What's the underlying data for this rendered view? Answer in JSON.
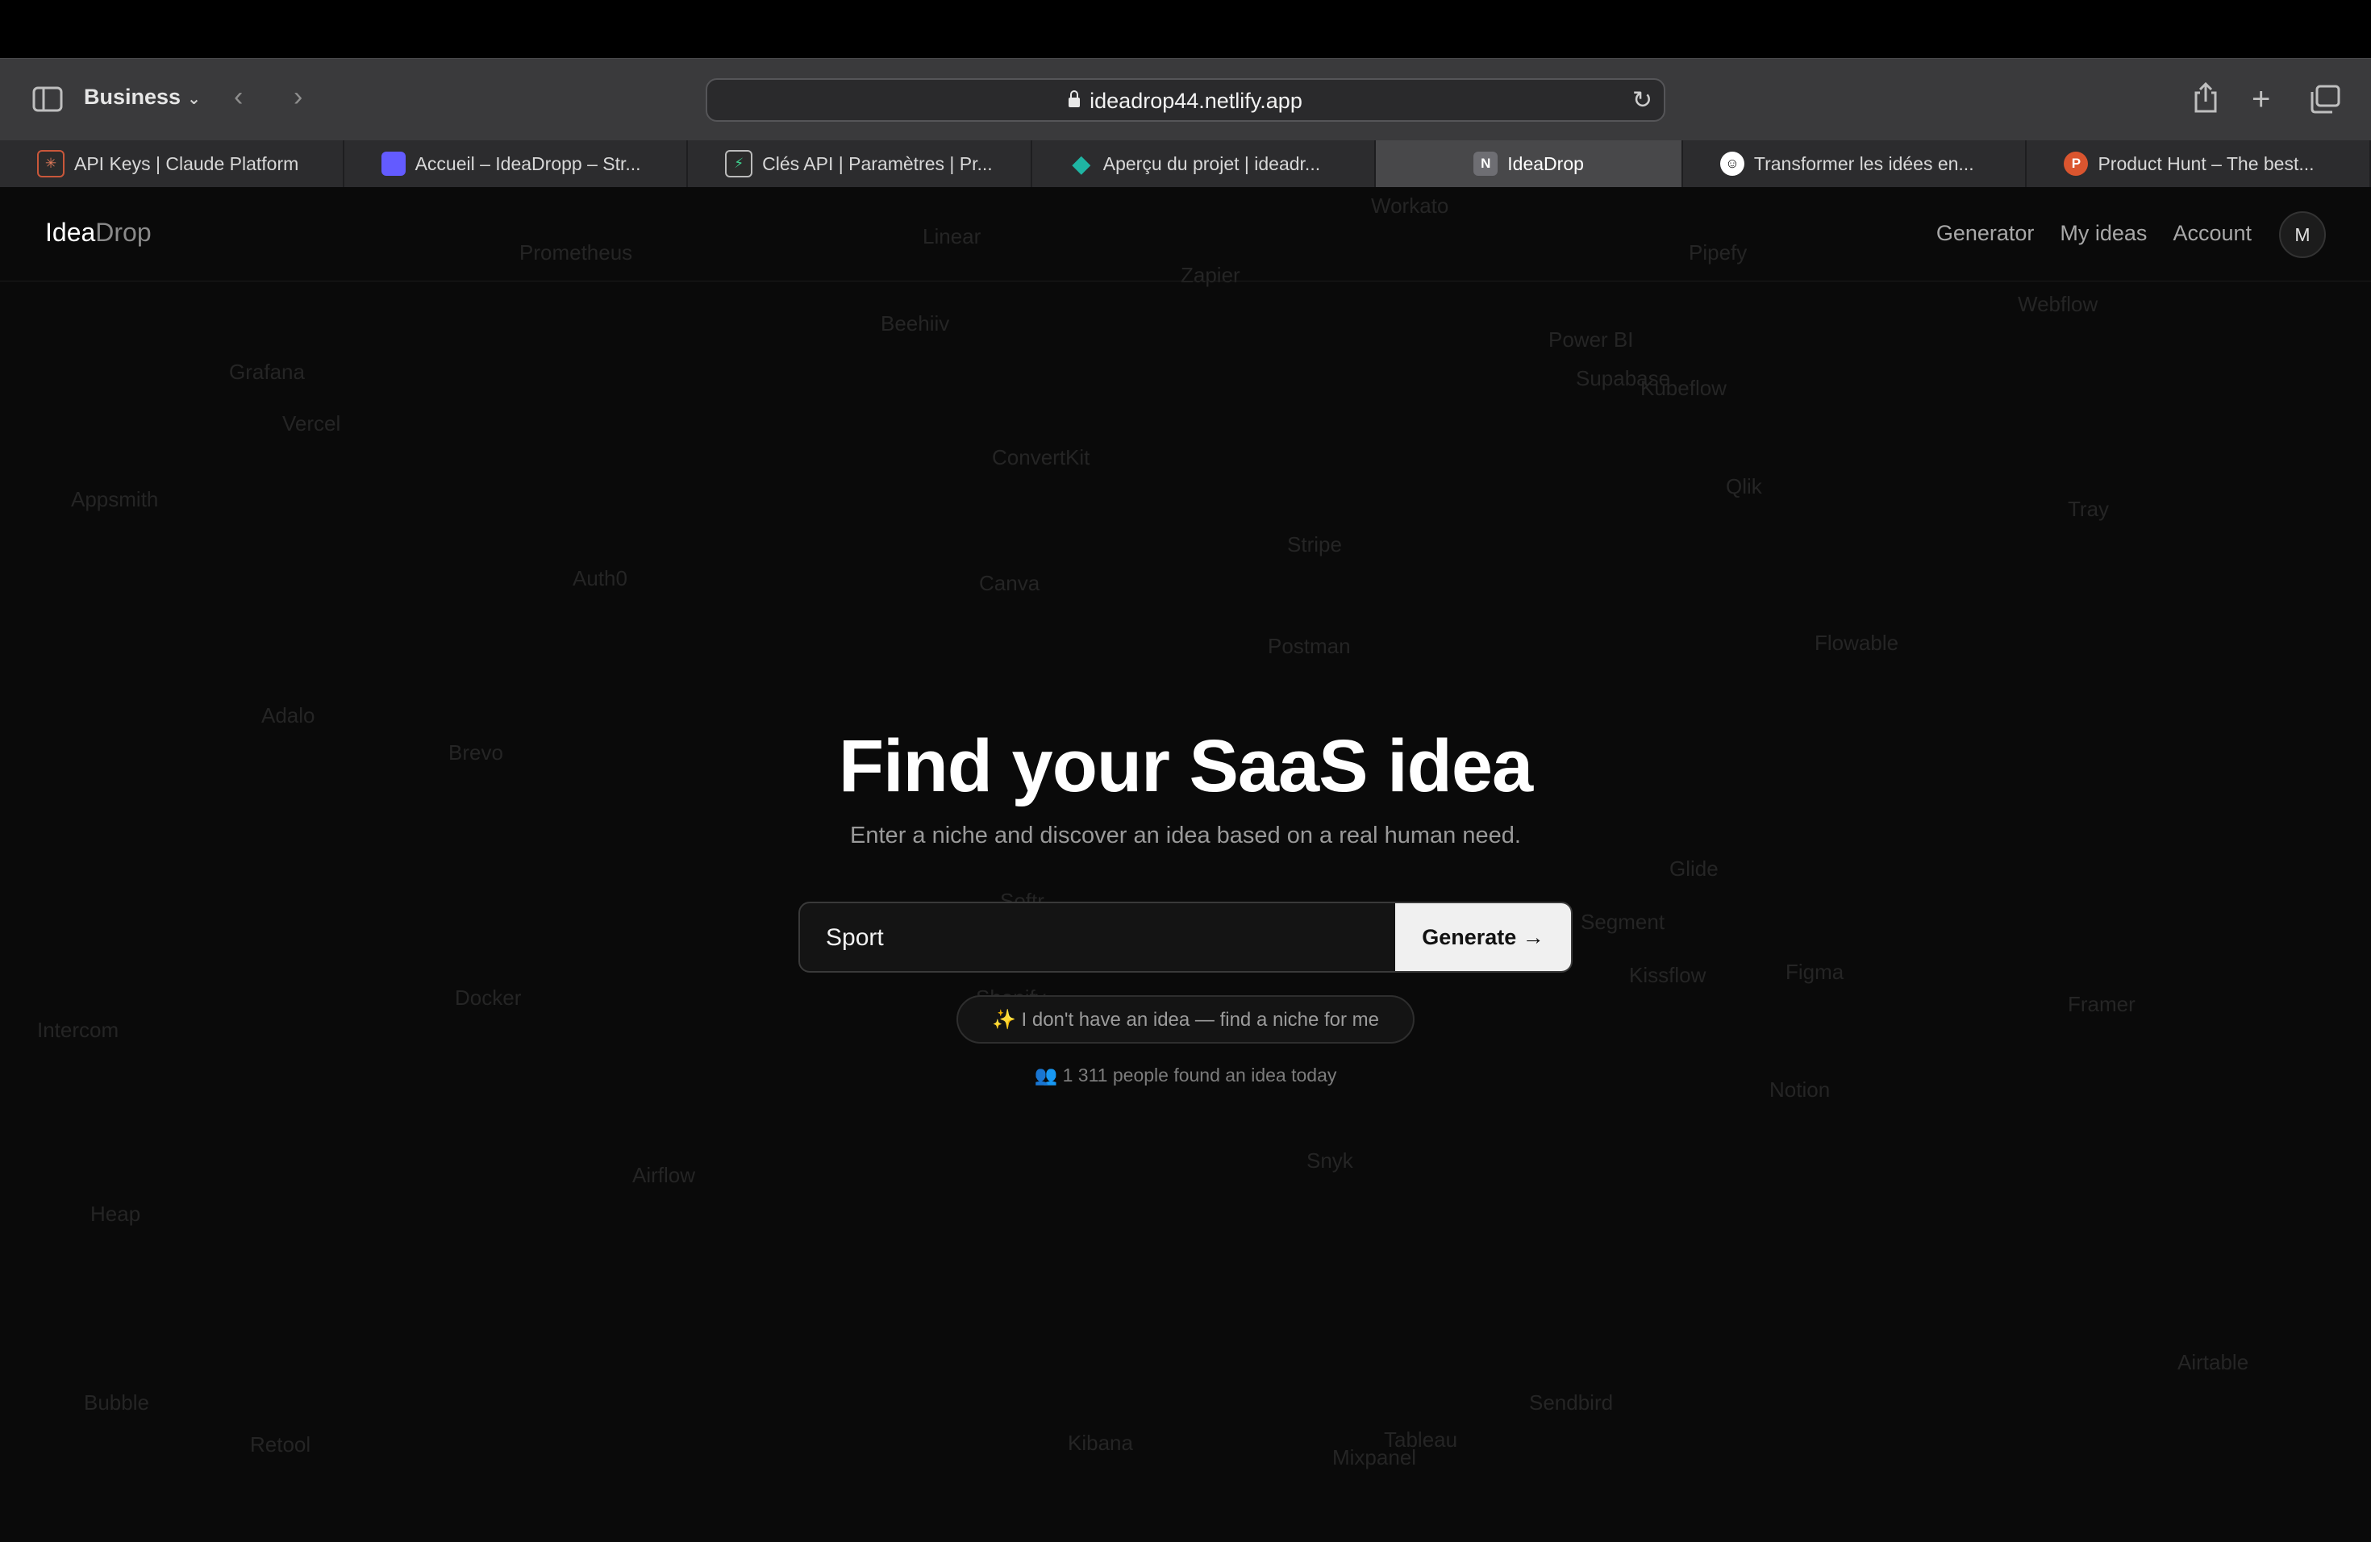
{
  "browser": {
    "profile": "Business",
    "url": "ideadrop44.netlify.app",
    "tabs": [
      {
        "label": "API Keys | Claude Platform",
        "favicon_color": "#c9573a"
      },
      {
        "label": "Accueil – IdeaDropp – Str...",
        "favicon_color": "#635bff"
      },
      {
        "label": "Clés API | Paramètres | Pr...",
        "favicon_color": "#2b2b2b"
      },
      {
        "label": "Aperçu du projet | ideadr...",
        "favicon_color": "#1fb5a3"
      },
      {
        "label": "IdeaDrop",
        "favicon_letter": "N",
        "favicon_color": "#6e6e73",
        "active": true
      },
      {
        "label": "Transformer les idées en...",
        "favicon_color": "#ffffff"
      },
      {
        "label": "Product Hunt – The best...",
        "favicon_letter": "P",
        "favicon_color": "#da552f"
      }
    ]
  },
  "app": {
    "logo_primary": "Idea",
    "logo_secondary": "Drop",
    "nav": [
      "Generator",
      "My ideas",
      "Account"
    ],
    "avatar_initial": "M"
  },
  "hero": {
    "title": "Find your SaaS idea",
    "subtitle": "Enter a niche and discover an idea based on a real human need.",
    "input_value": "Sport",
    "button_label": "Generate →",
    "niche_button": "✨ I don't have an idea — find a niche for me",
    "count_text": "👥 1 311 people found an idea today"
  },
  "background_words": [
    "Workato",
    "Prometheus",
    "Linear",
    "Pipefy",
    "Zapier",
    "Webflow",
    "Beehiiv",
    "Power BI",
    "Grafana",
    "Supabase",
    "Kubeflow",
    "Vercel",
    "ConvertKit",
    "Appsmith",
    "Qlik",
    "Tray",
    "Stripe",
    "Auth0",
    "Canva",
    "Postman",
    "Flowable",
    "Adalo",
    "Brevo",
    "Glide",
    "Softr",
    "Segment",
    "Kissflow",
    "Figma",
    "Docker",
    "Shopify",
    "Framer",
    "Intercom",
    "Notion",
    "Airflow",
    "Snyk",
    "Heap",
    "Airtable",
    "Sendbird",
    "Bubble",
    "Tableau",
    "Retool",
    "Kibana",
    "Mixpanel"
  ],
  "colors": {
    "page_bg": "#0a0a0a",
    "accent_button": "#f0f0f0",
    "toolbar_bg": "#3a3a3c"
  }
}
